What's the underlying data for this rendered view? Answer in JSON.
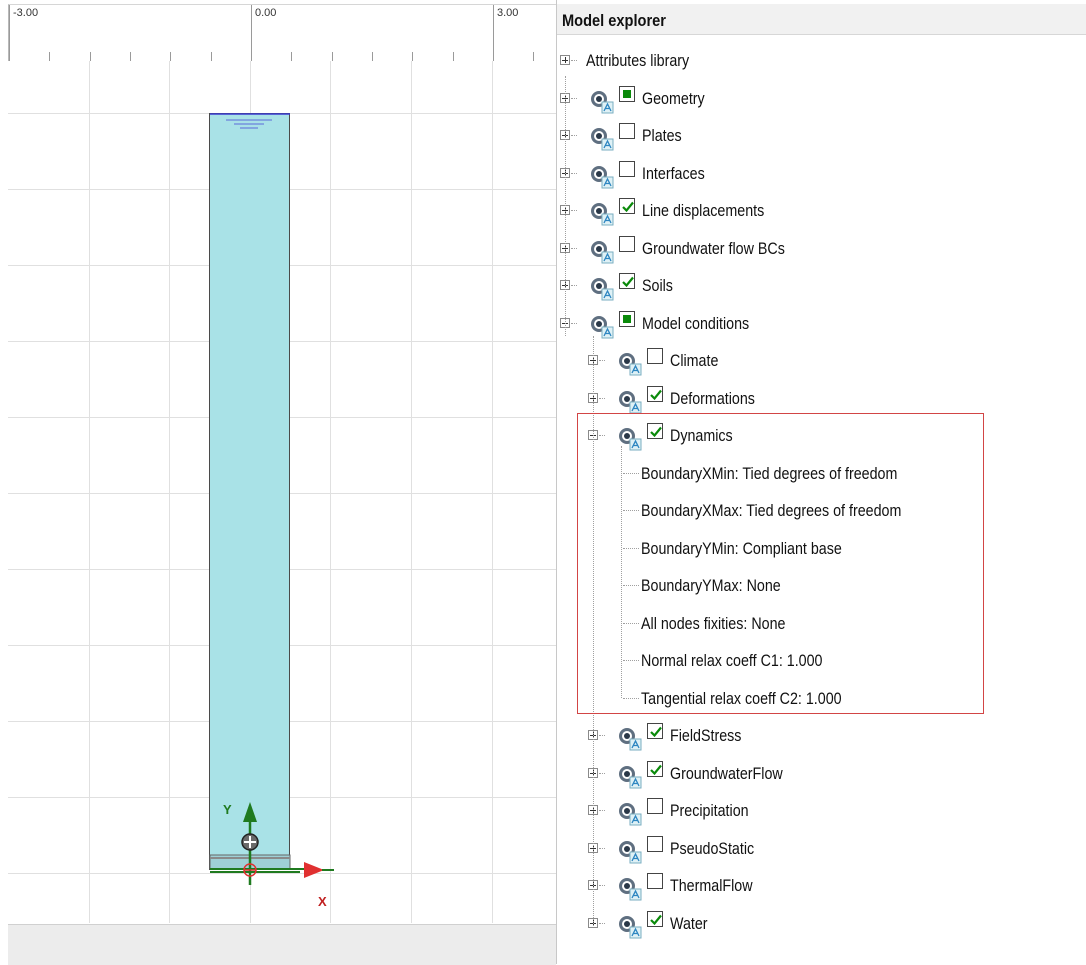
{
  "ruler": {
    "labels": [
      "-3.00",
      "0.00",
      "3.00"
    ]
  },
  "axes": {
    "y_label": "Y",
    "x_label": "X"
  },
  "colors": {
    "soil": "#a9e2e7",
    "check_green": "#0a8a0a",
    "axis_y": "#1f7a1f",
    "axis_x": "#e03030",
    "highlight": "#d24545"
  },
  "explorer": {
    "title": "Model explorer",
    "items": [
      {
        "label": "Attributes library",
        "expander": "plus",
        "eye": false,
        "check": "none"
      },
      {
        "label": "Geometry",
        "expander": "plus",
        "eye": true,
        "check": "partial"
      },
      {
        "label": "Plates",
        "expander": "plus",
        "eye": true,
        "check": "unchecked"
      },
      {
        "label": "Interfaces",
        "expander": "plus",
        "eye": true,
        "check": "unchecked"
      },
      {
        "label": "Line displacements",
        "expander": "plus",
        "eye": true,
        "check": "checked"
      },
      {
        "label": "Groundwater flow BCs",
        "expander": "plus",
        "eye": true,
        "check": "unchecked"
      },
      {
        "label": "Soils",
        "expander": "plus",
        "eye": true,
        "check": "checked"
      },
      {
        "label": "Model conditions",
        "expander": "minus",
        "eye": true,
        "check": "partial"
      },
      {
        "label": "Climate",
        "expander": "plus",
        "eye": true,
        "check": "unchecked"
      },
      {
        "label": "Deformations",
        "expander": "plus",
        "eye": true,
        "check": "checked"
      },
      {
        "label": "Dynamics",
        "expander": "minus",
        "eye": true,
        "check": "checked"
      },
      {
        "label": "BoundaryXMin: Tied degrees of freedom",
        "expander": "none",
        "eye": false,
        "check": "none"
      },
      {
        "label": "BoundaryXMax: Tied degrees of freedom",
        "expander": "none",
        "eye": false,
        "check": "none"
      },
      {
        "label": "BoundaryYMin: Compliant base",
        "expander": "none",
        "eye": false,
        "check": "none"
      },
      {
        "label": "BoundaryYMax: None",
        "expander": "none",
        "eye": false,
        "check": "none"
      },
      {
        "label": "All nodes fixities: None",
        "expander": "none",
        "eye": false,
        "check": "none"
      },
      {
        "label": "Normal relax coeff C1: 1.000",
        "expander": "none",
        "eye": false,
        "check": "none"
      },
      {
        "label": "Tangential relax coeff C2: 1.000",
        "expander": "none",
        "eye": false,
        "check": "none"
      },
      {
        "label": "FieldStress",
        "expander": "plus",
        "eye": true,
        "check": "checked"
      },
      {
        "label": "GroundwaterFlow",
        "expander": "plus",
        "eye": true,
        "check": "checked"
      },
      {
        "label": "Precipitation",
        "expander": "plus",
        "eye": true,
        "check": "unchecked"
      },
      {
        "label": "PseudoStatic",
        "expander": "plus",
        "eye": true,
        "check": "unchecked"
      },
      {
        "label": "ThermalFlow",
        "expander": "plus",
        "eye": true,
        "check": "unchecked"
      },
      {
        "label": "Water",
        "expander": "plus",
        "eye": true,
        "check": "checked"
      }
    ]
  }
}
